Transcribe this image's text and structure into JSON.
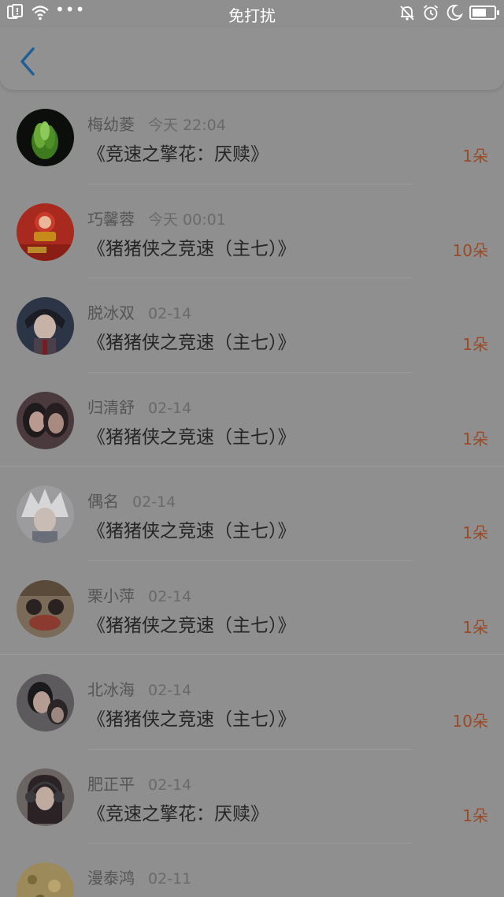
{
  "status_bar": {
    "title": "免打扰",
    "dots": "•••"
  },
  "nav": {
    "back_icon": "chevron-left-icon",
    "accent": "#1f5f96"
  },
  "list": [
    {
      "name": "梅幼菱",
      "time": "今天 22:04",
      "title": "《竞速之擎花：厌赎》",
      "count": "1朵",
      "avatar": "green-flower"
    },
    {
      "name": "巧馨蓉",
      "time": "今天 00:01",
      "title": "《猪猪侠之竞速（主七）》",
      "count": "10朵",
      "avatar": "red-envelope"
    },
    {
      "name": "脱冰双",
      "time": "02-14",
      "title": "《猪猪侠之竞速（主七）》",
      "count": "1朵",
      "avatar": "anime-boy"
    },
    {
      "name": "归清舒",
      "time": "02-14",
      "title": "《猪猪侠之竞速（主七）》",
      "count": "1朵",
      "avatar": "two-girls"
    },
    {
      "name": "偶名",
      "time": "02-14",
      "title": "《猪猪侠之竞速（主七）》",
      "count": "1朵",
      "avatar": "white-hair-anime"
    },
    {
      "name": "栗小萍",
      "time": "02-14",
      "title": "《猪猪侠之竞速（主七）》",
      "count": "1朵",
      "avatar": "cartoon-face"
    },
    {
      "name": "北冰海",
      "time": "02-14",
      "title": "《猪猪侠之竞速（主七）》",
      "count": "10朵",
      "avatar": "couple-photo"
    },
    {
      "name": "肥正平",
      "time": "02-14",
      "title": "《竞速之擎花：厌赎》",
      "count": "1朵",
      "avatar": "headphone-girl"
    },
    {
      "name": "漫泰鸿",
      "time": "02-11",
      "title": "",
      "count": "",
      "avatar": "yellow-pattern"
    }
  ],
  "colors": {
    "overlay_bg": "#8f8f8f",
    "count": "#9a4a24"
  }
}
